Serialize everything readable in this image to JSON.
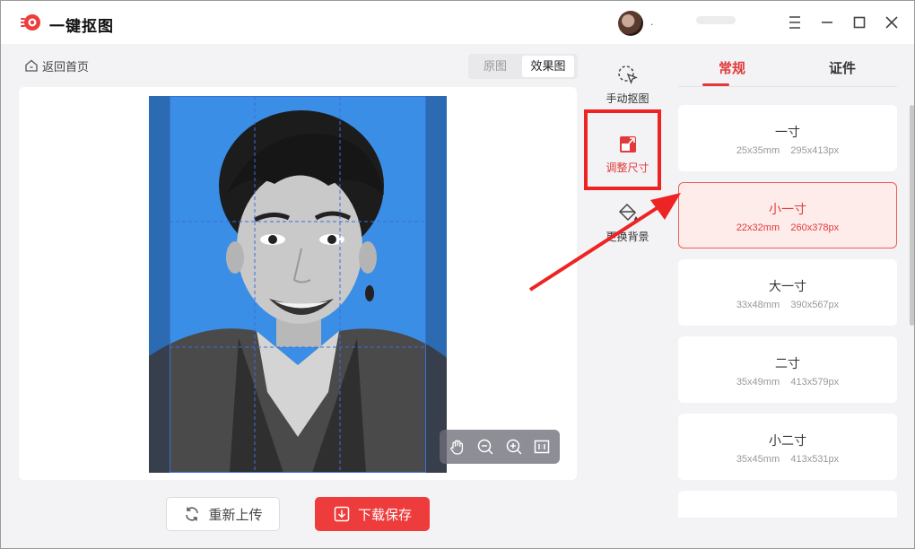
{
  "app": {
    "title": "一键抠图",
    "username": "."
  },
  "toolbar": {
    "back_label": "返回首页",
    "view_original": "原图",
    "view_effect": "效果图"
  },
  "tools": [
    {
      "label": "手动抠图",
      "icon": "cursor-select-icon"
    },
    {
      "label": "调整尺寸",
      "icon": "resize-icon"
    },
    {
      "label": "更换背景",
      "icon": "paint-bucket-icon"
    }
  ],
  "panel": {
    "tabs": [
      "常规",
      "证件"
    ],
    "sizes": [
      {
        "name": "一寸",
        "mm": "25x35mm",
        "px": "295x413px",
        "selected": false
      },
      {
        "name": "小一寸",
        "mm": "22x32mm",
        "px": "260x378px",
        "selected": true
      },
      {
        "name": "大一寸",
        "mm": "33x48mm",
        "px": "390x567px",
        "selected": false
      },
      {
        "name": "二寸",
        "mm": "35x49mm",
        "px": "413x579px",
        "selected": false
      },
      {
        "name": "小二寸",
        "mm": "35x45mm",
        "px": "413x531px",
        "selected": false
      }
    ]
  },
  "actions": {
    "reupload": "重新上传",
    "download": "下载保存"
  },
  "colors": {
    "accent": "#e23a3a",
    "photo_bg": "#3a8ee6",
    "annotation": "#ee2424"
  }
}
